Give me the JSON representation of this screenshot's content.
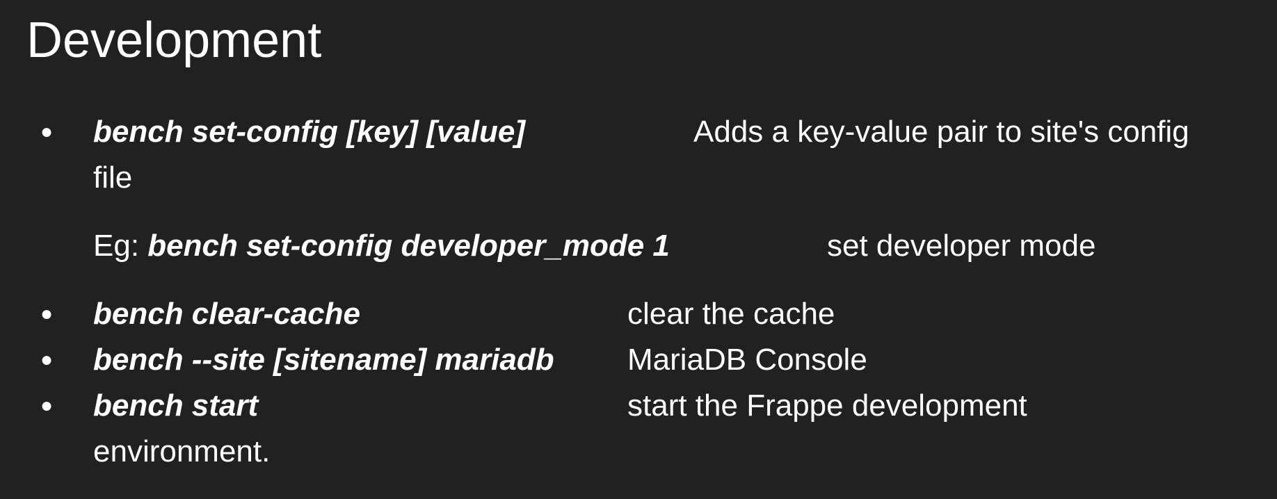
{
  "slide": {
    "title": "Development",
    "bullet_glyph": "●",
    "items": [
      {
        "command": "bench set-config [key] [value]",
        "description": "Adds a key-value pair to site's config",
        "description_wrap": "file",
        "example_prefix": "Eg: ",
        "example_command": "bench set-config developer_mode 1",
        "example_description": "set developer mode"
      },
      {
        "command": "bench clear-cache",
        "description": "clear the cache"
      },
      {
        "command": "bench --site [sitename]  mariadb",
        "description": "MariaDB Console"
      },
      {
        "command": "bench start",
        "description": "start the Frappe development",
        "description_wrap": "environment."
      }
    ]
  }
}
